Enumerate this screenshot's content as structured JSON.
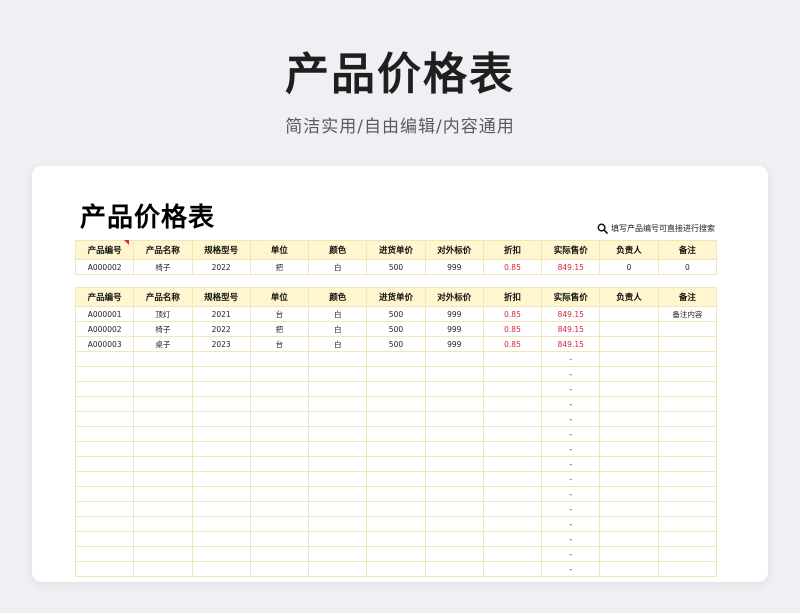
{
  "hero": {
    "title": "产品价格表",
    "subtitle": "简洁实用/自由编辑/内容通用"
  },
  "sheet": {
    "title": "产品价格表",
    "search_hint": "填写产品编号可直接进行搜索",
    "columns": [
      "产品编号",
      "产品名称",
      "规格型号",
      "单位",
      "颜色",
      "进货单价",
      "对外标价",
      "折扣",
      "实际售价",
      "负责人",
      "备注"
    ],
    "search_result": [
      "A000002",
      "椅子",
      "2022",
      "把",
      "白",
      "500",
      "999",
      "0.85",
      "849.15",
      "0",
      "0"
    ],
    "rows": [
      [
        "A000001",
        "顶灯",
        "2021",
        "台",
        "白",
        "500",
        "999",
        "0.85",
        "849.15",
        "",
        "备注内容"
      ],
      [
        "A000002",
        "椅子",
        "2022",
        "把",
        "白",
        "500",
        "999",
        "0.85",
        "849.15",
        "",
        ""
      ],
      [
        "A000003",
        "桌子",
        "2023",
        "台",
        "白",
        "500",
        "999",
        "0.85",
        "849.15",
        "",
        ""
      ]
    ],
    "empty_row_price_placeholder": "-",
    "empty_row_count": 15
  },
  "colors": {
    "header_bg": "#fff6cf",
    "grid_line": "#f1e6b8",
    "price_red": "#d7263d"
  }
}
